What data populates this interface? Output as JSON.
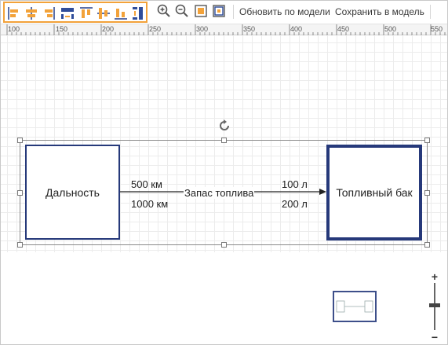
{
  "toolbar": {
    "align_tools": [
      {
        "name": "align-left-icon"
      },
      {
        "name": "align-center-icon"
      },
      {
        "name": "align-right-icon"
      },
      {
        "name": "distribute-horizontal-icon"
      },
      {
        "name": "align-top-icon"
      },
      {
        "name": "align-middle-icon"
      },
      {
        "name": "align-bottom-icon"
      },
      {
        "name": "distribute-vertical-icon"
      }
    ],
    "view_tools": [
      {
        "name": "zoom-in-icon"
      },
      {
        "name": "zoom-out-icon"
      },
      {
        "name": "fit-to-screen-icon"
      },
      {
        "name": "actual-size-icon"
      }
    ],
    "update_from_model_label": "Обновить по модели",
    "save_to_model_label": "Сохранить в модель",
    "accent_color": "#f2a23a"
  },
  "ruler": {
    "labels": [
      "100",
      "150",
      "200",
      "250",
      "300",
      "350",
      "400",
      "450",
      "500",
      "550"
    ]
  },
  "diagram": {
    "nodes": [
      {
        "id": "range",
        "label": "Дальность"
      },
      {
        "id": "tank",
        "label": "Топливный бак"
      }
    ],
    "edge": {
      "label": "Запас топлива",
      "source_labels": [
        "500 км",
        "1000 км"
      ],
      "target_labels": [
        "100 л",
        "200 л"
      ]
    },
    "node_border_color": "#26397a"
  },
  "zoom": {
    "plus_label": "+",
    "minus_label": "−",
    "level": 0.45
  }
}
